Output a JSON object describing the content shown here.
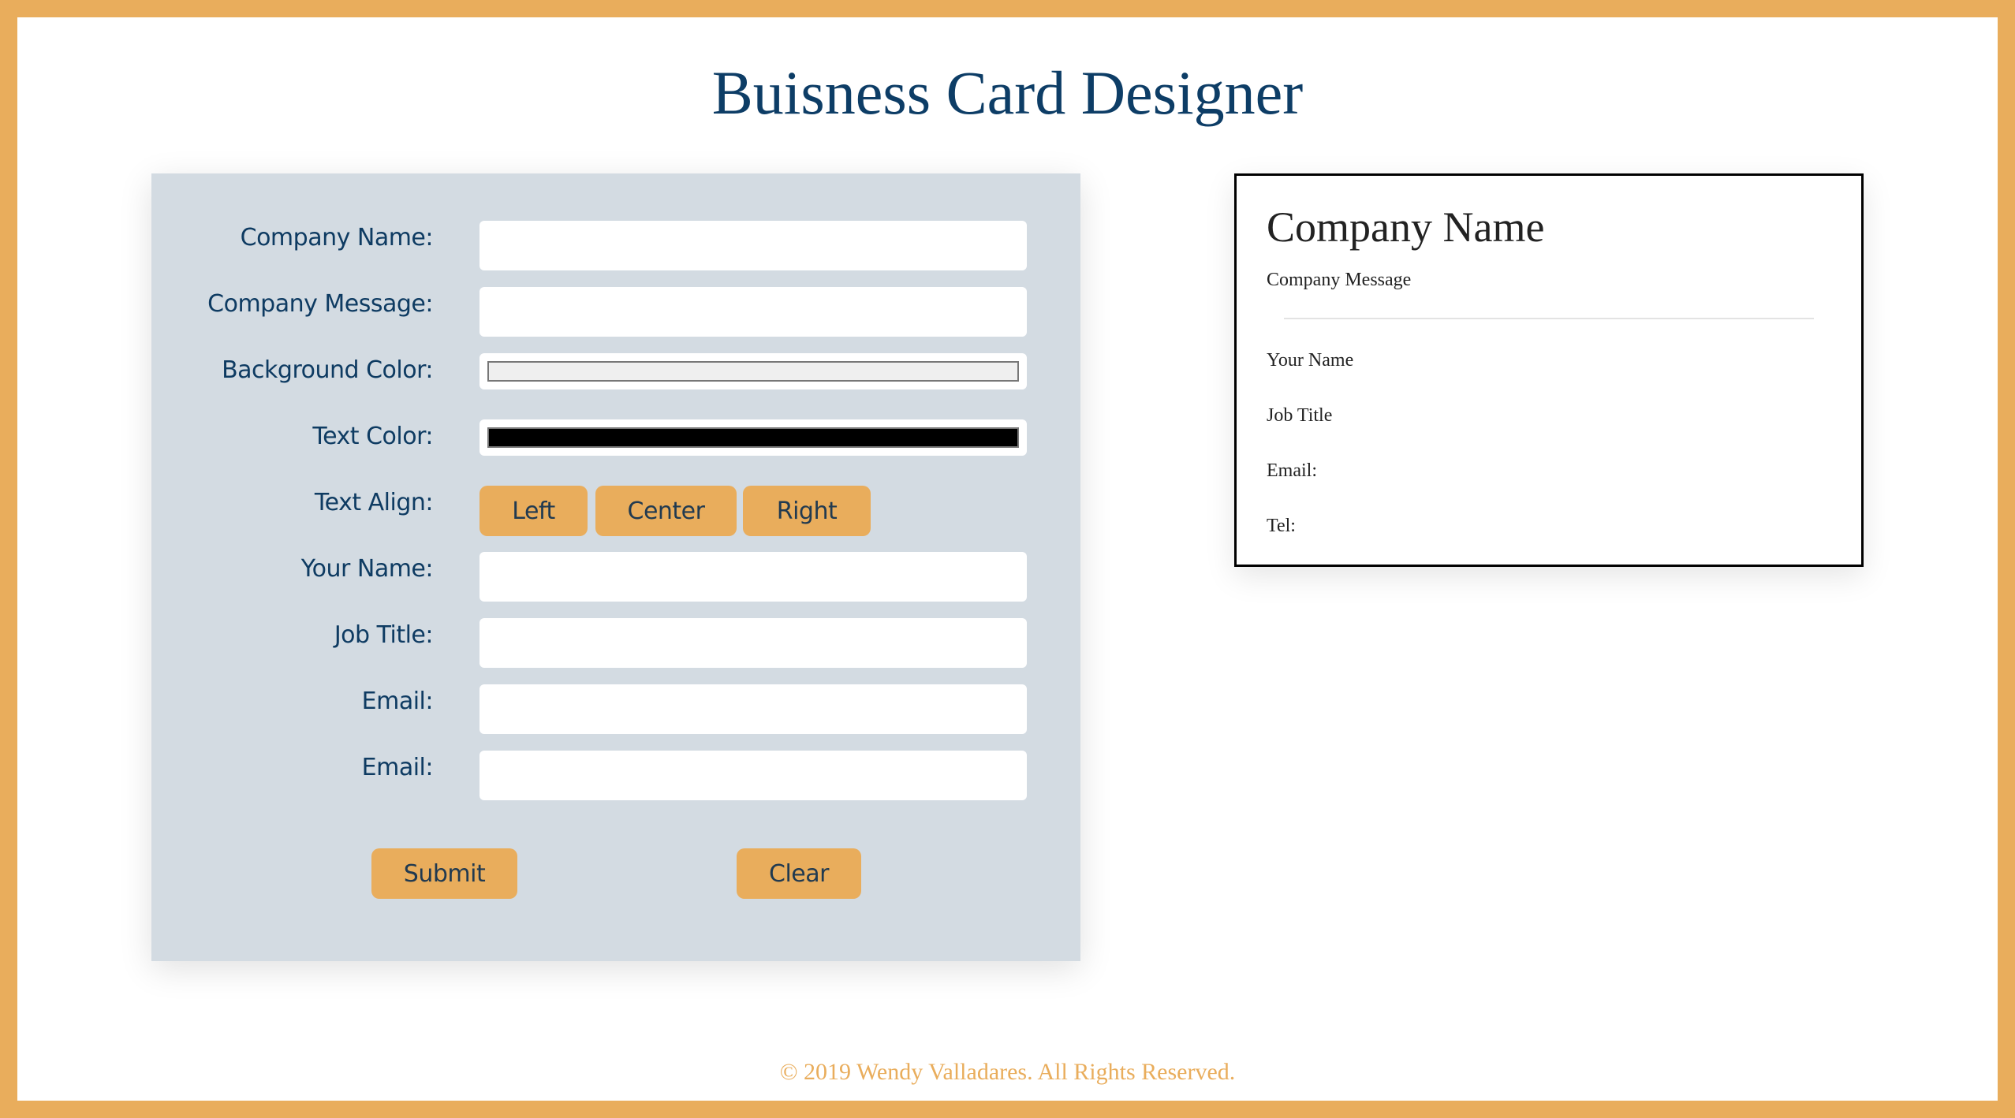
{
  "header": {
    "title": "Buisness Card Designer"
  },
  "form": {
    "fields": [
      {
        "label": "Company Name:",
        "value": "",
        "placeholder": ""
      },
      {
        "label": "Company Message:",
        "value": "",
        "placeholder": ""
      },
      {
        "label": "Background Color:",
        "value": "#efefef"
      },
      {
        "label": "Text Color:",
        "value": "#000000"
      },
      {
        "label": "Text Align:"
      },
      {
        "label": "Your Name:",
        "value": "",
        "placeholder": ""
      },
      {
        "label": "Job Title:",
        "value": "",
        "placeholder": ""
      },
      {
        "label": "Email:",
        "value": "",
        "placeholder": ""
      },
      {
        "label": "Email:",
        "value": "",
        "placeholder": ""
      }
    ],
    "align_buttons": {
      "left": "Left",
      "center": "Center",
      "right": "Right"
    },
    "submit_label": "Submit",
    "clear_label": "Clear"
  },
  "card": {
    "company_name": "Company Name",
    "company_message": "Company Message",
    "your_name": "Your Name",
    "job_title": "Job Title",
    "email": "Email:",
    "tel": "Tel:"
  },
  "footer": {
    "text": "© 2019 Wendy Valladares. All Rights Reserved."
  },
  "colors": {
    "accent": "#e9ad5c",
    "navy": "#0d3d66",
    "panel": "#d3dbe2"
  }
}
